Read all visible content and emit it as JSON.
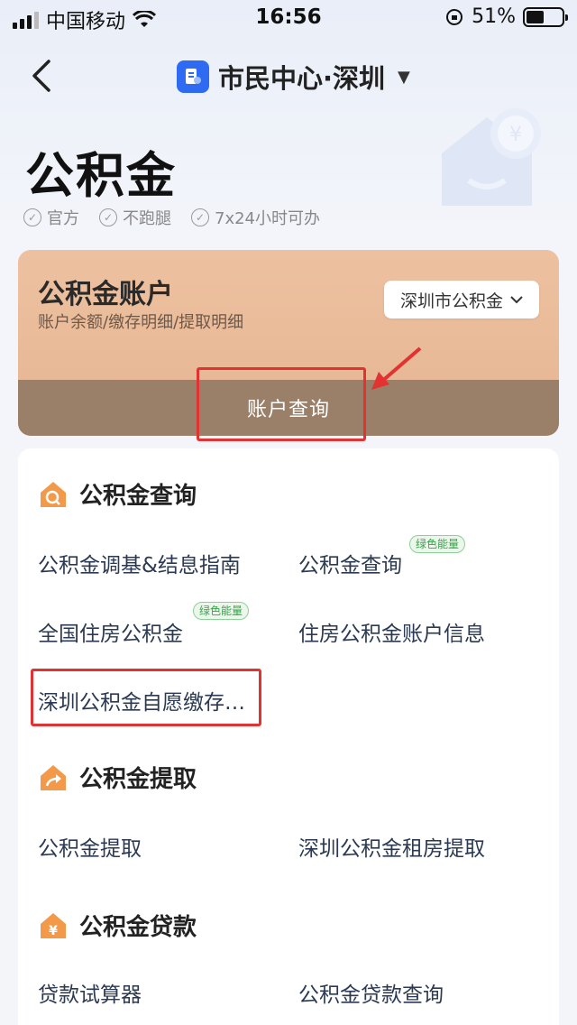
{
  "status_bar": {
    "carrier": "中国移动",
    "time": "16:56",
    "battery": "51%",
    "battery_level_percent": 51
  },
  "nav": {
    "title": "市民中心·深圳",
    "brand_color": "#2f6bf2"
  },
  "header": {
    "title": "公积金",
    "tags": [
      "官方",
      "不跑腿",
      "7x24小时可办"
    ]
  },
  "account_card": {
    "title": "公积金账户",
    "subtitle": "账户余额/缴存明细/提取明细",
    "select_value": "深圳市公积金",
    "action_label": "账户查询",
    "highlight_color": "#e23232"
  },
  "sections": [
    {
      "title": "公积金查询",
      "icon": "house-search-icon",
      "items": [
        {
          "label": "公积金调基&结息指南",
          "badge": ""
        },
        {
          "label": "公积金查询",
          "badge": "绿色能量"
        },
        {
          "label": "全国住房公积金",
          "badge": "绿色能量"
        },
        {
          "label": "住房公积金账户信息",
          "badge": ""
        },
        {
          "label": "深圳公积金自愿缴存…",
          "badge": ""
        }
      ]
    },
    {
      "title": "公积金提取",
      "icon": "house-arrow-icon",
      "items": [
        {
          "label": "公积金提取",
          "badge": ""
        },
        {
          "label": "深圳公积金租房提取",
          "badge": ""
        }
      ]
    },
    {
      "title": "公积金贷款",
      "icon": "house-yen-icon",
      "items": [
        {
          "label": "贷款试算器",
          "badge": ""
        },
        {
          "label": "公积金贷款查询",
          "badge": ""
        }
      ]
    }
  ]
}
